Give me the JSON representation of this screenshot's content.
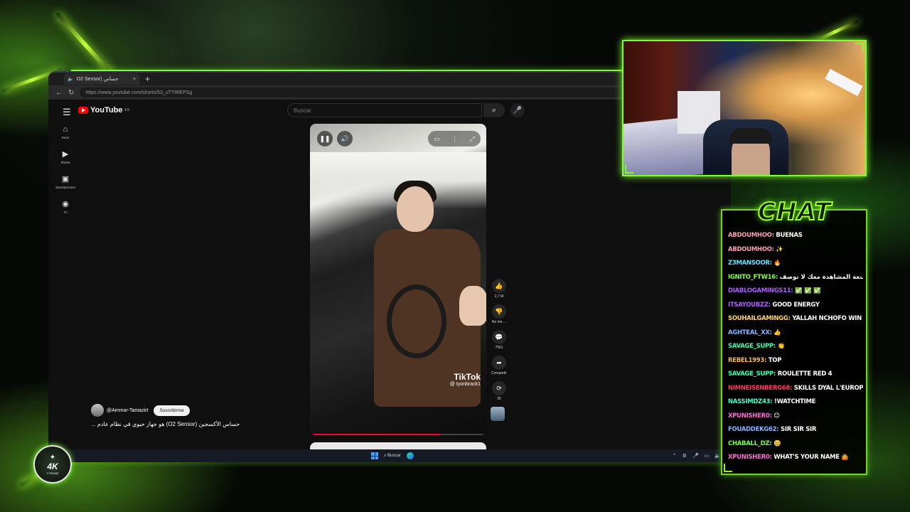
{
  "browser": {
    "tab_title": "O2 Sensor) حساس",
    "new_tab": "+",
    "close": "×",
    "url": "https://www.youtube.com/shorts/53_uTYWEPSg"
  },
  "youtube": {
    "logo_text": "YouTube",
    "logo_region": "ES",
    "search_placeholder": "Buscar",
    "sidebar": [
      {
        "icon": "home-icon",
        "glyph": "⌂",
        "label": "Inicio"
      },
      {
        "icon": "shorts-icon",
        "glyph": "▶",
        "label": "Shorts"
      },
      {
        "icon": "subscriptions-icon",
        "glyph": "▣",
        "label": "Suscripciones"
      },
      {
        "icon": "profile-icon",
        "glyph": "◉",
        "label": "Tú"
      }
    ],
    "actions": [
      {
        "icon": "like-icon",
        "glyph": "👍",
        "count": "2,7 M"
      },
      {
        "icon": "dislike-icon",
        "glyph": "👎",
        "count": "No me ..."
      },
      {
        "icon": "comment-icon",
        "glyph": "💬",
        "count": "7561"
      },
      {
        "icon": "share-icon",
        "glyph": "➦",
        "count": "Compartir"
      },
      {
        "icon": "remix-icon",
        "glyph": "⟳",
        "count": "35"
      }
    ],
    "channel": "@Ammar-Tamazirt",
    "subscribe_label": "Suscribirme",
    "video_title": "حساس الأكسجين (O2 Sensor) هو جهاز حيوي في نظام عادم ...",
    "tiktok_brand": "TikTok",
    "tiktok_handle": "@ tyonbrack1",
    "progress_fraction": 0.74
  },
  "taskbar": {
    "search_label": "Buscar"
  },
  "chat": {
    "title": "CHAT",
    "messages": [
      {
        "user": "ABDOUMHOO:",
        "color": "#ff9db5",
        "text": "BUENAS"
      },
      {
        "user": "ABDOUMHOO:",
        "color": "#ff9db5",
        "text": "✨"
      },
      {
        "user": "Z3MANSOOR:",
        "color": "#69e0ff",
        "text": "🔥"
      },
      {
        "user": "IGNITO_FTW16:",
        "color": "#7dff4a",
        "text": "متعة المشاهدة معك لا توصف"
      },
      {
        "user": "DIABLOGAMINGS11:",
        "color": "#b05cff",
        "text": "✅ ✅ ✅"
      },
      {
        "user": "ITSAYOUBZZ:",
        "color": "#b05cff",
        "text": "GOOD ENERGY"
      },
      {
        "user": "SOUHAILGAMINGG:",
        "color": "#ffd86b",
        "text": "YALLAH NCHOFO WIN"
      },
      {
        "user": "AGHTEAL_XX:",
        "color": "#8ab4ff",
        "text": "👍"
      },
      {
        "user": "SAVAGE_SUPP:",
        "color": "#3dffb0",
        "text": "👏"
      },
      {
        "user": "REBEL1993:",
        "color": "#ffb35c",
        "text": "TOP"
      },
      {
        "user": "SAVAGE_SUPP:",
        "color": "#3dffb0",
        "text": "ROULETTE RED 4"
      },
      {
        "user": "NIMNEISENBERG68:",
        "color": "#ff3b5c",
        "text": "SKILLS DYAL L'EUROPE HADO."
      },
      {
        "user": "NASSIMDZ43:",
        "color": "#3dffd0",
        "text": "!WATCHTIME"
      },
      {
        "user": "XPUNISHER0:",
        "color": "#ff6bd5",
        "text": "😊"
      },
      {
        "user": "FOUADDEKG62:",
        "color": "#8ab4ff",
        "text": "SIR SIR SIR"
      },
      {
        "user": "CHABALL_DZ:",
        "color": "#7dff4a",
        "text": "🤐"
      },
      {
        "user": "XPUNISHER0:",
        "color": "#ff6bd5",
        "text": "WHAT'S YOUR NAME 🤷"
      }
    ]
  },
  "badge": {
    "text": "4K",
    "sub": "TYRONE"
  },
  "colors": {
    "accent_green": "#7dff2d",
    "youtube_red": "#ff0000"
  }
}
